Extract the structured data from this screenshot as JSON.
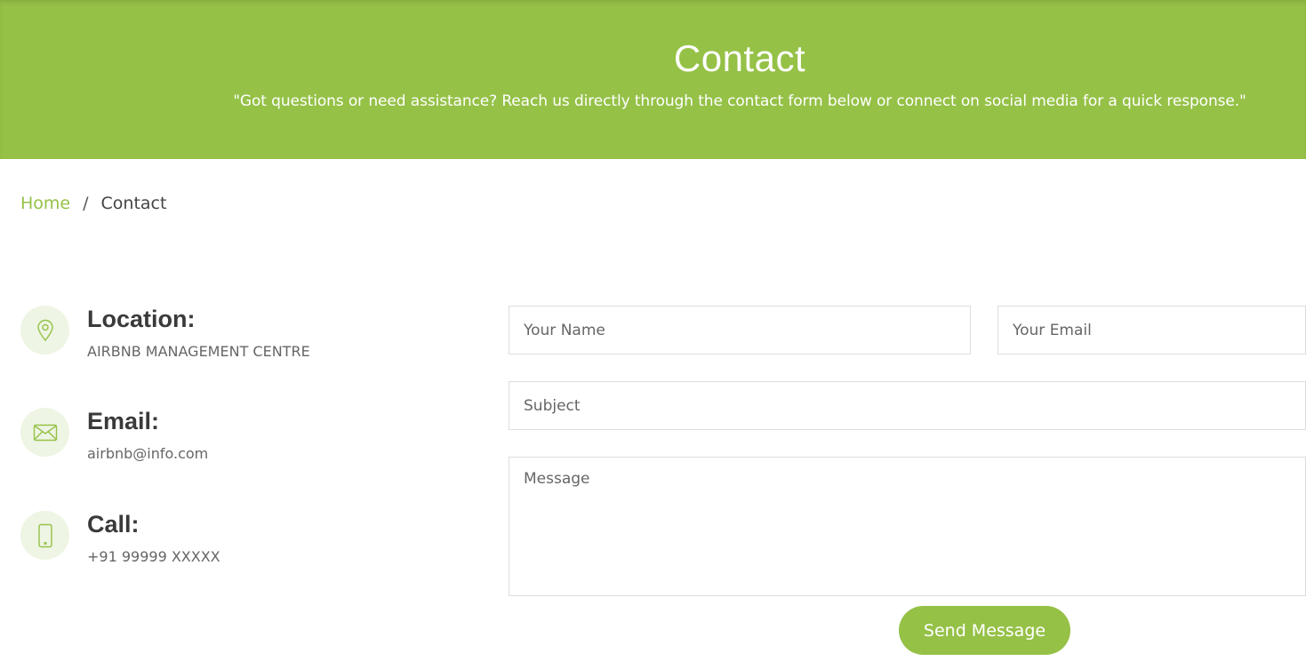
{
  "hero": {
    "title": "Contact",
    "subtitle": "\"Got questions or need assistance? Reach us directly through the contact form below or connect on social media for a quick response.\""
  },
  "breadcrumb": {
    "home": "Home",
    "separator": "/",
    "current": "Contact"
  },
  "info": {
    "location": {
      "title": "Location:",
      "value": "AIRBNB MANAGEMENT CENTRE",
      "icon": "map-pin-icon"
    },
    "email": {
      "title": "Email:",
      "value": "airbnb@info.com",
      "icon": "envelope-icon"
    },
    "call": {
      "title": "Call:",
      "value": "+91 99999 XXXXX",
      "icon": "phone-icon"
    }
  },
  "form": {
    "name_placeholder": "Your Name",
    "email_placeholder": "Your Email",
    "subject_placeholder": "Subject",
    "message_placeholder": "Message",
    "submit_label": "Send Message"
  },
  "colors": {
    "accent": "#95c147",
    "icon_bg": "#eef5e4"
  }
}
